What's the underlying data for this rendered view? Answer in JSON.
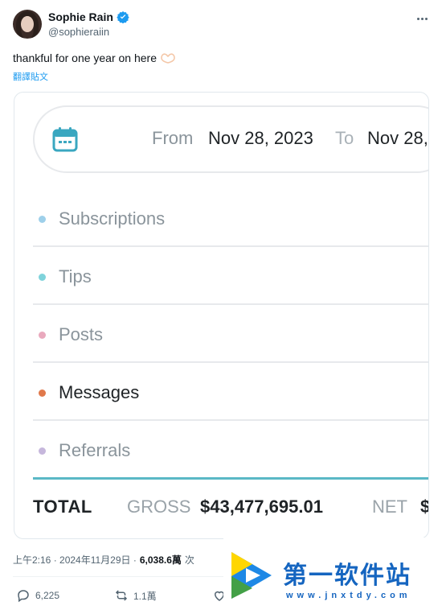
{
  "author": {
    "display_name": "Sophie Rain",
    "handle": "@sophieraiin"
  },
  "tweet": {
    "text": "thankful for one year on here",
    "translate_label": "翻譯貼文"
  },
  "media": {
    "date_range": {
      "from_label": "From",
      "from_date": "Nov 28, 2023",
      "to_label": "To",
      "to_date": "Nov 28,"
    },
    "categories": [
      {
        "label": "Subscriptions",
        "color": "#9ed0ea"
      },
      {
        "label": "Tips",
        "color": "#7fd3db"
      },
      {
        "label": "Posts",
        "color": "#e9a9bd"
      },
      {
        "label": "Messages",
        "color": "#e0794b"
      },
      {
        "label": "Referrals",
        "color": "#c6b7dc"
      }
    ],
    "totals": {
      "total_label": "TOTAL",
      "gross_label": "GROSS",
      "gross_value": "$43,477,695.01",
      "net_label": "NET",
      "net_value": "$"
    }
  },
  "meta": {
    "timestamp": "上午2:16 · 2024年11月29日 ·",
    "views": "6,038.6萬",
    "views_suffix": "次"
  },
  "actions": {
    "replies": "6,225",
    "reposts": "1.1萬"
  },
  "watermark": {
    "title": "第一软件站",
    "url": "www.jnxtdy.com"
  },
  "colors": {
    "accent": "#1d9bf0",
    "total_bar": "#5ab8c6"
  }
}
